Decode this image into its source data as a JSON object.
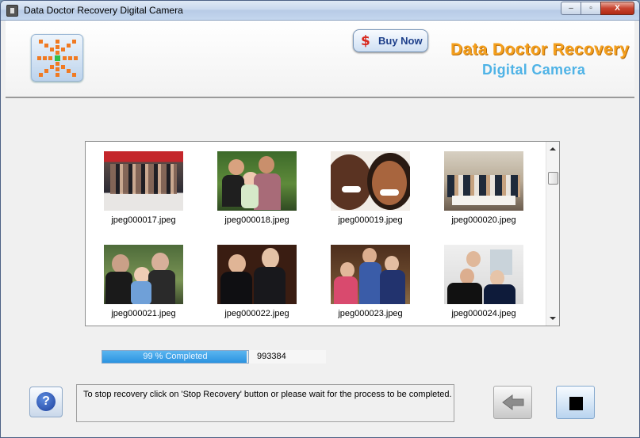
{
  "window": {
    "title": "Data Doctor Recovery Digital Camera",
    "controls": {
      "minimize": "–",
      "maximize": "▫",
      "close": "X"
    }
  },
  "header": {
    "buy_now_label": "Buy Now",
    "buy_now_symbol": "$",
    "brand_line1": "Data Doctor Recovery",
    "brand_line2": "Digital Camera",
    "colors": {
      "brand1": "#f5a01d",
      "brand2": "#4fb3e6"
    }
  },
  "gallery": {
    "items": [
      {
        "filename": "jpeg000017.jpeg"
      },
      {
        "filename": "jpeg000018.jpeg"
      },
      {
        "filename": "jpeg000019.jpeg"
      },
      {
        "filename": "jpeg000020.jpeg"
      },
      {
        "filename": "jpeg000021.jpeg"
      },
      {
        "filename": "jpeg000022.jpeg"
      },
      {
        "filename": "jpeg000023.jpeg"
      },
      {
        "filename": "jpeg000024.jpeg"
      }
    ]
  },
  "progress": {
    "percent": 99,
    "label": "99 % Completed",
    "count": "993384",
    "color": "#2b93e0"
  },
  "footer": {
    "help_symbol": "?",
    "message": "To stop recovery click on 'Stop Recovery' button or please wait for the process to be completed."
  },
  "icons": {
    "logo": "asterisk-grid-icon",
    "help": "question-icon",
    "back": "arrow-left-icon",
    "stop": "stop-icon"
  }
}
